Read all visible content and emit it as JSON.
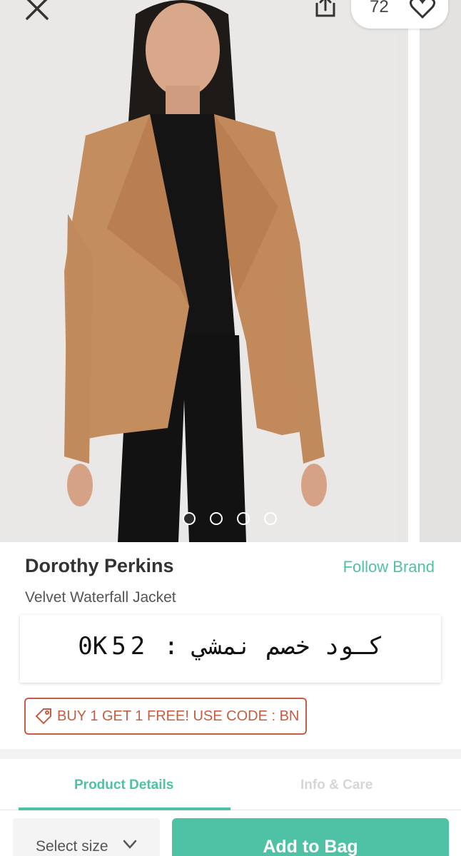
{
  "header": {
    "favorites_count": "72"
  },
  "gallery": {
    "image_count": 4,
    "active_index": 0
  },
  "product": {
    "brand": "Dorothy Perkins",
    "follow_label": "Follow Brand",
    "name": "Velvet Waterfall Jacket"
  },
  "discount": {
    "text": "كـود خصم نمشي : 0K52"
  },
  "promo": {
    "text": "BUY 1 GET 1 FREE! USE CODE : BN"
  },
  "tabs": [
    {
      "label": "Product Details",
      "active": true
    },
    {
      "label": "Info & Care",
      "active": false
    }
  ],
  "bottom": {
    "size_placeholder": "Select size",
    "add_label": "Add to Bag"
  },
  "colors": {
    "accent": "#4fc1a5",
    "promo": "#c45e42",
    "jacket": "#c48d5e",
    "background": "#e9e7e6"
  }
}
